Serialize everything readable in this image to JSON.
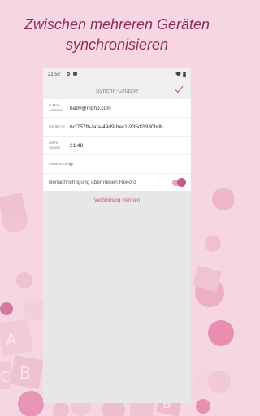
{
  "promo": {
    "line1": "Zwischen mehreren Geräten",
    "line2": "synchronisieren"
  },
  "status_bar": {
    "time": "21:52",
    "icons": [
      "gear-icon",
      "shield-icon",
      "wifi-icon",
      "battery-icon"
    ]
  },
  "app_bar": {
    "title": "Synchr.-Gruppe",
    "confirm_icon": "checkmark-icon"
  },
  "fields": [
    {
      "label": "E-Mail-Adresse",
      "value": "baby@nighp.com"
    },
    {
      "label": "Geräte-ID",
      "value": "6cf757fb-fafa-49d9-bec1-935d2f930bdb"
    },
    {
      "label": "Letzte Synchr.",
      "value": "21:48"
    },
    {
      "label": "Fehleranzahl",
      "value": "0"
    }
  ],
  "notify_toggle": {
    "label": "Benachrichtigung über neuen Rekord",
    "on": true
  },
  "disconnect_label": "Verbindung trennen",
  "colors": {
    "accent": "#c05a8a",
    "promo_text": "#8e2d5e",
    "background": "#f6d6e1"
  }
}
